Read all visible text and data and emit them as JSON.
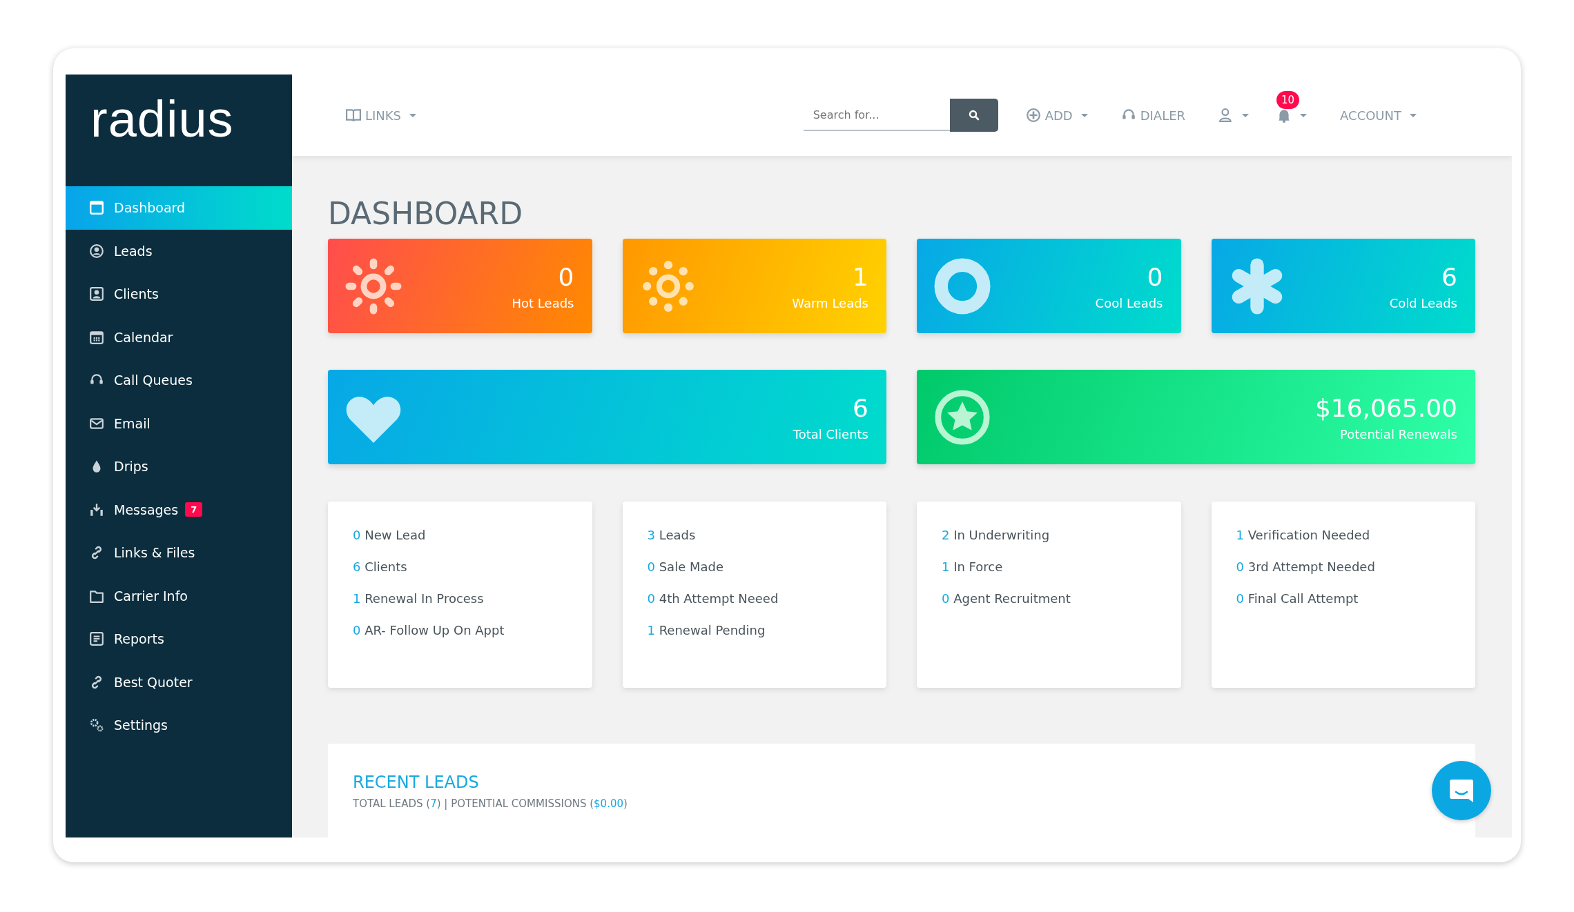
{
  "sidebar": {
    "logo": "radius",
    "items": [
      {
        "label": "Dashboard",
        "selected": true
      },
      {
        "label": "Leads",
        "selected": false
      },
      {
        "label": "Clients",
        "selected": false
      },
      {
        "label": "Calendar",
        "selected": false
      },
      {
        "label": "Call Queues",
        "selected": false
      },
      {
        "label": "Email",
        "selected": false
      },
      {
        "label": "Drips",
        "selected": false
      },
      {
        "label": "Messages",
        "selected": false,
        "badge": "7"
      },
      {
        "label": "Links & Files",
        "selected": false
      },
      {
        "label": "Carrier Info",
        "selected": false
      },
      {
        "label": "Reports",
        "selected": false
      },
      {
        "label": "Best Quoter",
        "selected": false
      },
      {
        "label": "Settings",
        "selected": false
      }
    ]
  },
  "topbar": {
    "links": "LINKS",
    "search": {
      "placeholder": "Search for..."
    },
    "add": "ADD",
    "dialer": "DIALER",
    "notifications_badge": "10",
    "account": "ACCOUNT"
  },
  "page_title": "DASHBOARD",
  "stat_cards": [
    {
      "value": "0",
      "label": "Hot Leads",
      "color": "#ff4d4d"
    },
    {
      "value": "1",
      "label": "Warm Leads",
      "color": "#ff9800"
    },
    {
      "value": "0",
      "label": "Cool Leads",
      "color": "#07a8e6"
    },
    {
      "value": "6",
      "label": "Cold Leads",
      "color": "#07a8e6"
    }
  ],
  "summary_cards": [
    {
      "value": "6",
      "label": "Total Clients",
      "color": "#07a8e6"
    },
    {
      "value": "$16,065.00",
      "label": "Potential Renewals",
      "color": "#00c96a"
    }
  ],
  "status_cards": [
    {
      "items": [
        {
          "count": "0",
          "label": "New Lead"
        },
        {
          "count": "6",
          "label": "Clients"
        },
        {
          "count": "1",
          "label": "Renewal In Process"
        },
        {
          "count": "0",
          "label": "AR- Follow Up On Appt"
        }
      ]
    },
    {
      "items": [
        {
          "count": "3",
          "label": "Leads"
        },
        {
          "count": "0",
          "label": "Sale Made"
        },
        {
          "count": "0",
          "label": "4th Attempt Neeed"
        },
        {
          "count": "1",
          "label": "Renewal Pending"
        }
      ]
    },
    {
      "items": [
        {
          "count": "2",
          "label": "In Underwriting"
        },
        {
          "count": "1",
          "label": "In Force"
        },
        {
          "count": "0",
          "label": "Agent Recruitment"
        }
      ]
    },
    {
      "items": [
        {
          "count": "1",
          "label": "Verification Needed"
        },
        {
          "count": "0",
          "label": "3rd Attempt Needed"
        },
        {
          "count": "0",
          "label": "Final Call Attempt"
        }
      ]
    }
  ],
  "recent_leads": {
    "title": "RECENT LEADS",
    "summary": [
      {
        "kind": "plain",
        "text": "TOTAL LEADS ("
      },
      {
        "kind": "value",
        "text": "7"
      },
      {
        "kind": "plain",
        "text": ") | POTENTIAL COMMISSIONS ("
      },
      {
        "kind": "value",
        "text": "$0.00"
      },
      {
        "kind": "plain",
        "text": ")"
      }
    ]
  }
}
